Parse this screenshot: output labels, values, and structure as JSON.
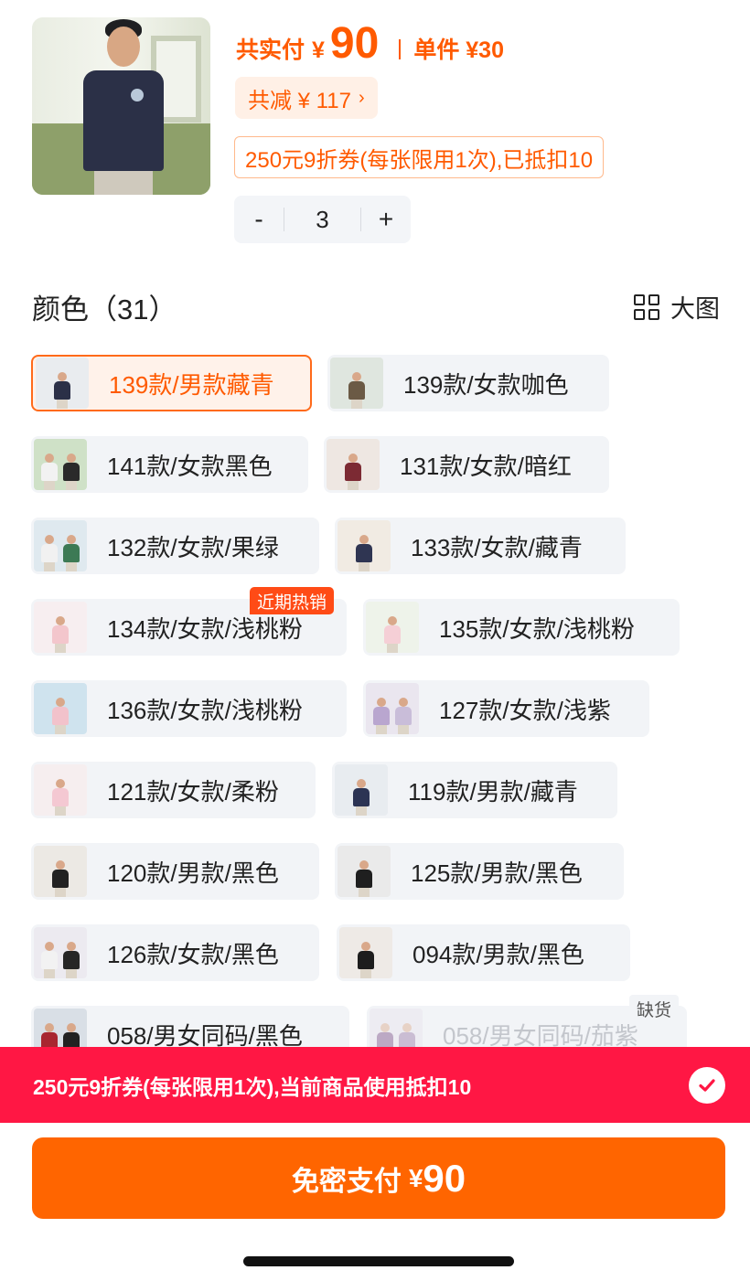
{
  "product": {
    "total_paid_label": "共实付",
    "currency": "¥",
    "total_amount": "90",
    "unit_price_label": "单件 ¥30",
    "discount_text": "共减 ¥ 117",
    "coupon_note": "250元9折券(每张限用1次),已抵扣10",
    "quantity": "3",
    "minus_label": "-",
    "plus_label": "+"
  },
  "section": {
    "title": "颜色（31）",
    "big_view_label": "大图"
  },
  "options": [
    {
      "label": "139款/男款藏青",
      "selected": true,
      "shirt": "#2b3047"
    },
    {
      "label": "139款/女款咖色",
      "shirt": "#6b5a45"
    },
    {
      "label": "141款/女款黑色",
      "shirt": "#2a2a2a"
    },
    {
      "label": "131款/女款/暗红",
      "shirt": "#7c2a33"
    },
    {
      "label": "132款/女款/果绿",
      "shirt": "#3d7a55"
    },
    {
      "label": "133款/女款/藏青",
      "shirt": "#2f3552"
    },
    {
      "label": "134款/女款/浅桃粉",
      "shirt": "#f3c6cc"
    },
    {
      "label": "135款/女款/浅桃粉",
      "shirt": "#f5cfd6"
    },
    {
      "label": "136款/女款/浅桃粉",
      "shirt": "#f2c2cb"
    },
    {
      "label": "127款/女款/浅紫",
      "shirt": "#b9a6cf"
    },
    {
      "label": "121款/女款/柔粉",
      "shirt": "#f4c8d2"
    },
    {
      "label": "119款/男款/藏青",
      "shirt": "#2c3454"
    },
    {
      "label": "120款/男款/黑色",
      "shirt": "#222222"
    },
    {
      "label": "125款/男款/黑色",
      "shirt": "#1f1f1f"
    },
    {
      "label": "126款/女款/黑色",
      "shirt": "#262626"
    },
    {
      "label": "094款/男款/黑色",
      "shirt": "#1d1d1d"
    },
    {
      "label": "058/男女同码/黑色",
      "shirt": "#a82630"
    },
    {
      "label": "058/男女同码/茄紫",
      "soldout": true,
      "shirt": "#7a4e86"
    }
  ],
  "badges": {
    "hot": "近期热销",
    "soldout": "缺货"
  },
  "coupon_bar": {
    "text": "250元9折券(每张限用1次),当前商品使用抵扣10"
  },
  "pay": {
    "label": "免密支付",
    "currency": "¥",
    "amount": "90"
  },
  "colors": {
    "accent": "#ff5a00",
    "coupon_bar": "#ff1744",
    "button": "#ff6500",
    "chip_bg": "#f2f4f7"
  }
}
